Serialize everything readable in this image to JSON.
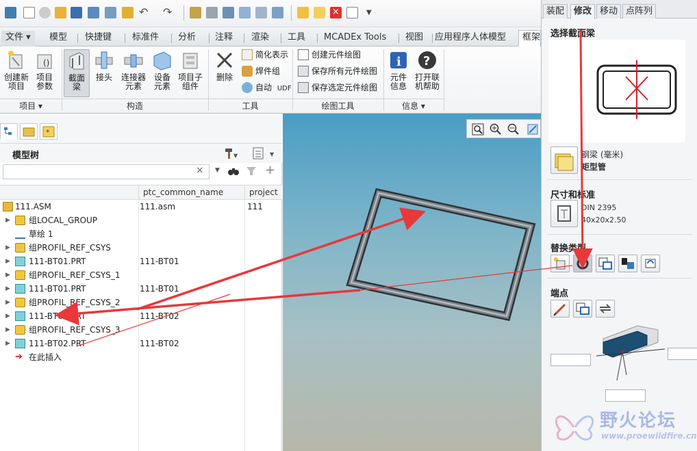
{
  "ribbon_tabs": [
    {
      "label": "文件 ▾"
    },
    {
      "label": "模型"
    },
    {
      "label": "快捷键"
    },
    {
      "label": "标准件"
    },
    {
      "label": "分析"
    },
    {
      "label": "注释"
    },
    {
      "label": "渲染"
    },
    {
      "label": "工具"
    },
    {
      "label": "MCADEx Tools"
    },
    {
      "label": "视图"
    },
    {
      "label": "应用程序人体模型"
    },
    {
      "label": "框架"
    }
  ],
  "ribbon": {
    "new_item": "创建新\n项目",
    "item_params": "项目\n参数",
    "section_beam": "截面\n梁",
    "joint": "接头",
    "connector_element": "连接器\n元素",
    "device_element": "设备\n元素",
    "item_subcomponent": "项目子\n组件",
    "delete": "删除",
    "simplified_rep": "简化表示",
    "weld_group": "焊件组",
    "auto": "自动",
    "udf": "UDF",
    "create_drawing": "创建元件绘图",
    "save_all_drawings": "保存所有元件绘图",
    "save_selected_drawings": "保存选定元件绘图",
    "component_info": "元件\n信息",
    "open_help": "打开联\n机帮助",
    "groups": {
      "item": "项目 ▾",
      "construct": "构造",
      "tools": "工具",
      "drawing_tools": "绘图工具",
      "info": "信息 ▾"
    }
  },
  "tree": {
    "title": "模型树",
    "search_value": "",
    "columns": [
      "ptc_common_name",
      "project"
    ],
    "rows": [
      {
        "name": "111.ASM",
        "common": "111.asm",
        "project": "111",
        "icon": "assembly-icon",
        "expand": false
      },
      {
        "name": "组LOCAL_GROUP",
        "common": "",
        "project": "",
        "icon": "group-icon",
        "expand": true
      },
      {
        "name": "草绘 1",
        "common": "",
        "project": "",
        "icon": "sketch-icon",
        "expand": false
      },
      {
        "name": "组PROFIL_REF_CSYS",
        "common": "",
        "project": "",
        "icon": "group-icon",
        "expand": true
      },
      {
        "name": "111-BT01.PRT",
        "common": "111-BT01",
        "project": "",
        "icon": "part-icon",
        "expand": true
      },
      {
        "name": "组PROFIL_REF_CSYS_1",
        "common": "",
        "project": "",
        "icon": "group-icon",
        "expand": true
      },
      {
        "name": "111-BT01.PRT",
        "common": "111-BT01",
        "project": "",
        "icon": "part-icon",
        "expand": true
      },
      {
        "name": "组PROFIL_REF_CSYS_2",
        "common": "",
        "project": "",
        "icon": "group-icon",
        "expand": true
      },
      {
        "name": "111-BT02.PRT",
        "common": "111-BT02",
        "project": "",
        "icon": "part-icon",
        "expand": true
      },
      {
        "name": "组PROFIL_REF_CSYS_3",
        "common": "",
        "project": "",
        "icon": "group-icon",
        "expand": true
      },
      {
        "name": "111-BT02.PRT",
        "common": "111-BT02",
        "project": "",
        "icon": "part-icon",
        "expand": true
      },
      {
        "name": "在此插入",
        "common": "",
        "project": "",
        "icon": "insert-here-icon",
        "expand": false
      }
    ]
  },
  "panel": {
    "tabs": [
      "装配",
      "修改",
      "移动",
      "点阵列"
    ],
    "active_tab": "修改",
    "select_section": "选择截面梁",
    "beam_category": "钢梁 (毫米)",
    "beam_type": "矩型管",
    "dims_header": "尺寸和标准",
    "standard": "DIN 2395",
    "size": "40x20x2.50",
    "replace_header": "替换类型",
    "endpoint_header": "端点"
  },
  "watermark": {
    "title": "野火论坛",
    "url": "www.proewildfire.cn"
  },
  "colors": {
    "annotation_arrow": "#e8383a",
    "accent": "#0a3c8a"
  }
}
